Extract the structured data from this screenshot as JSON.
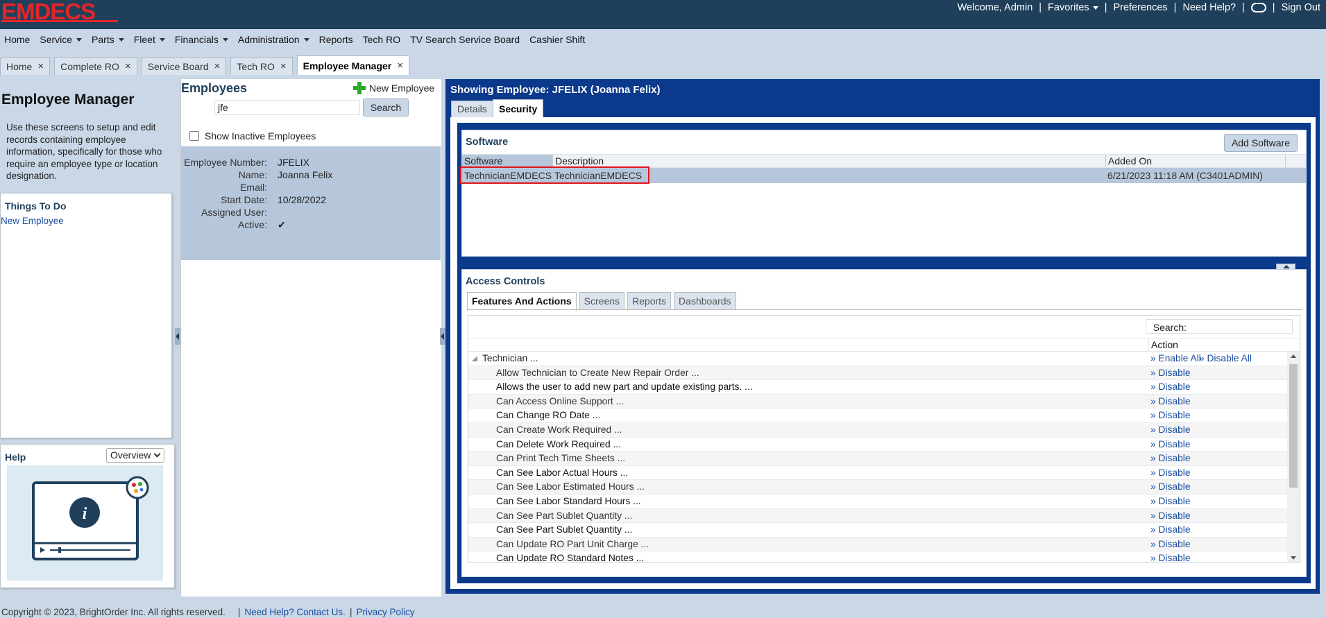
{
  "app": {
    "logo": "EMDECS",
    "welcome": "Welcome, Admin",
    "favorites": "Favorites",
    "preferences": "Preferences",
    "need_help": "Need Help?",
    "sign_out": "Sign Out",
    "separator": "|"
  },
  "menu": [
    "Home",
    "Service",
    "Parts",
    "Fleet",
    "Financials",
    "Administration",
    "Reports",
    "Tech RO",
    "TV Search Service Board",
    "Cashier Shift"
  ],
  "menu_dropdowns": [
    false,
    true,
    true,
    true,
    true,
    true,
    false,
    false,
    false,
    false
  ],
  "tabs": [
    {
      "label": "Home",
      "active": false
    },
    {
      "label": "Complete RO",
      "active": false
    },
    {
      "label": "Service Board",
      "active": false
    },
    {
      "label": "Tech RO",
      "active": false
    },
    {
      "label": "Employee Manager",
      "active": true
    }
  ],
  "tab_close_glyph": "×",
  "left": {
    "title": "Employee Manager",
    "description": "Use these screens to setup and edit records containing employee information, specifically for those who require an employee type or location designation.",
    "todo_title": "Things To Do",
    "todo_link": "New Employee",
    "help_title": "Help",
    "help_select": "Overview"
  },
  "employees": {
    "title": "Employees",
    "new_employee": "New Employee",
    "search_value": "jfe",
    "search_button": "Search",
    "show_inactive": "Show Inactive Employees",
    "fields": [
      {
        "label": "Employee Number:",
        "value": "JFELIX"
      },
      {
        "label": "Name:",
        "value": "Joanna Felix"
      },
      {
        "label": "Email:",
        "value": ""
      },
      {
        "label": "Start Date:",
        "value": "10/28/2022"
      },
      {
        "label": "Assigned User:",
        "value": ""
      },
      {
        "label": "Active:",
        "value": "✔"
      }
    ]
  },
  "detail": {
    "showing": "Showing Employee: JFELIX (Joanna Felix)",
    "tab_details": "Details",
    "tab_security": "Security"
  },
  "software": {
    "title": "Software",
    "add_button": "Add Software",
    "columns": [
      "Software",
      "Description",
      "Added On"
    ],
    "rows": [
      {
        "software": "TechnicianEMDECS",
        "description": "TechnicianEMDECS",
        "added_on": "6/21/2023 11:18 AM (C3401ADMIN)"
      }
    ]
  },
  "access": {
    "title": "Access Controls",
    "tabs": [
      "Features And Actions",
      "Screens",
      "Reports",
      "Dashboards"
    ],
    "search_label": "Search:",
    "action_header": "Action",
    "group": {
      "label": "Technician   ...",
      "enable_all": "» Enable All",
      "disable_all": "» Disable All"
    },
    "disable_label": "» Disable",
    "items": [
      "Allow Technician to Create New Repair Order   ...",
      "Allows the user to add new part and update existing parts.   ...",
      "Can Access Online Support   ...",
      "Can Change RO Date   ...",
      "Can Create Work Required   ...",
      "Can Delete Work Required   ...",
      "Can Print Tech Time Sheets   ...",
      "Can See Labor Actual Hours   ...",
      "Can See Labor Estimated Hours   ...",
      "Can See Labor Standard Hours   ...",
      "Can See Part Sublet Quantity   ...",
      "Can See Part Sublet Quantity   ...",
      "Can Update RO Part Unit Charge   ...",
      "Can Update RO Standard Notes   ..."
    ]
  },
  "footer": {
    "copyright": "Copyright © 2023, BrightOrder Inc. All rights reserved.",
    "help_link": "Need Help? Contact Us.",
    "privacy": "Privacy Policy",
    "separator": "|"
  },
  "colors": {
    "brand": "#e3262a",
    "header": "#1f3f5b",
    "panel": "#0b3a8c",
    "selection": "#b6c7db",
    "highlight": "#e0161c"
  }
}
